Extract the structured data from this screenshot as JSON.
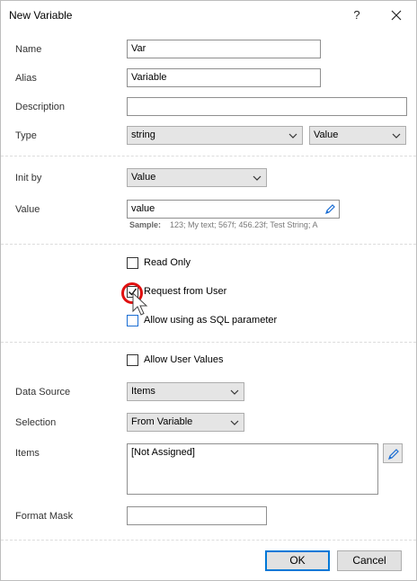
{
  "window": {
    "title": "New Variable",
    "help_label": "?"
  },
  "fields": {
    "name": {
      "label": "Name",
      "value": "Var"
    },
    "alias": {
      "label": "Alias",
      "value": "Variable"
    },
    "description": {
      "label": "Description",
      "value": ""
    },
    "type": {
      "label": "Type",
      "value": "string",
      "kind_value": "Value"
    }
  },
  "init": {
    "label": "Init by",
    "value": "Value",
    "value_label": "Value",
    "value_field": "value",
    "sample_label": "Sample:",
    "sample_text": "123; My text; 567f; 456.23f; Test String; A"
  },
  "options": {
    "read_only": {
      "label": "Read Only",
      "checked": false
    },
    "request_from_user": {
      "label": "Request from User",
      "checked": true
    },
    "allow_sql": {
      "label": "Allow using as SQL parameter",
      "checked": false
    }
  },
  "request": {
    "allow_user_values": {
      "label": "Allow User Values",
      "checked": false
    },
    "data_source": {
      "label": "Data Source",
      "value": "Items"
    },
    "selection": {
      "label": "Selection",
      "value": "From Variable"
    },
    "items": {
      "label": "Items",
      "value": "[Not Assigned]"
    },
    "format_mask": {
      "label": "Format Mask",
      "value": ""
    }
  },
  "buttons": {
    "ok": "OK",
    "cancel": "Cancel"
  },
  "colors": {
    "accent": "#0078d7",
    "highlight": "#e01010"
  }
}
